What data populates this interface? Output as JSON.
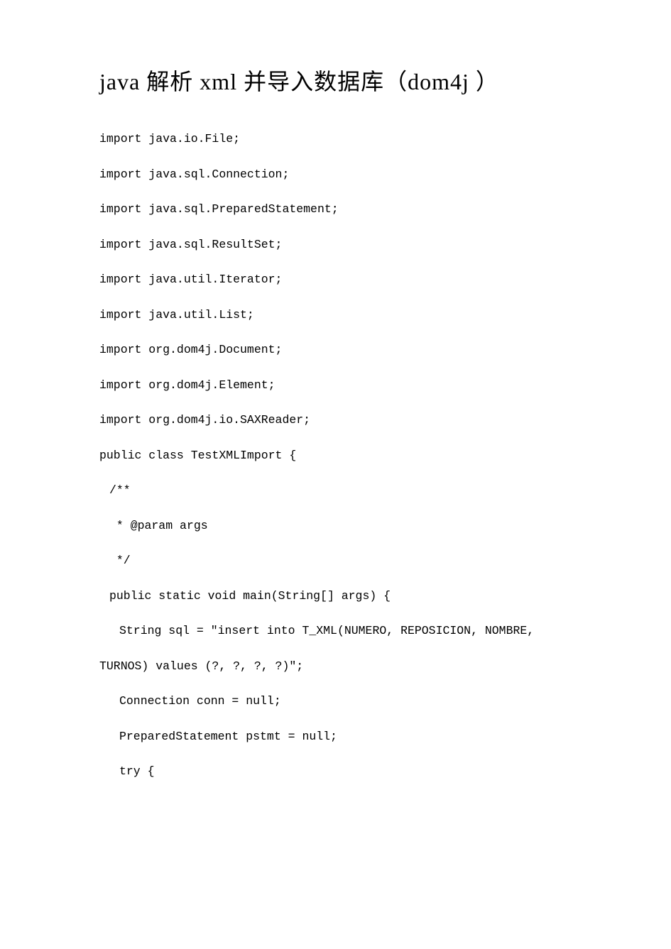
{
  "title": "java 解析 xml 并导入数据库（dom4j ）",
  "lines": [
    {
      "text": "import java.io.File;",
      "indent": 0
    },
    {
      "text": "import java.sql.Connection;",
      "indent": 0
    },
    {
      "text": "import java.sql.PreparedStatement;",
      "indent": 0
    },
    {
      "text": "import java.sql.ResultSet;",
      "indent": 0
    },
    {
      "text": "import java.util.Iterator;",
      "indent": 0
    },
    {
      "text": "import java.util.List;",
      "indent": 0
    },
    {
      "text": "",
      "indent": 0
    },
    {
      "text": "import org.dom4j.Document;",
      "indent": 0
    },
    {
      "text": "import org.dom4j.Element;",
      "indent": 0
    },
    {
      "text": "import org.dom4j.io.SAXReader;",
      "indent": 0
    },
    {
      "text": "",
      "indent": 0
    },
    {
      "text": "public class TestXMLImport {",
      "indent": 0
    },
    {
      "text": "",
      "indent": 0
    },
    {
      "text": "/**",
      "indent": 1
    },
    {
      "text": " * @param args",
      "indent": 1
    },
    {
      "text": " */",
      "indent": 1
    },
    {
      "text": "public static void main(String[] args) {",
      "indent": 1
    },
    {
      "text": "String sql = \"insert into T_XML(NUMERO, REPOSICION, NOMBRE,",
      "indent": 2
    },
    {
      "text": "TURNOS) values (?, ?, ?, ?)\";",
      "indent": 0
    },
    {
      "text": "Connection conn = null;",
      "indent": 2
    },
    {
      "text": "PreparedStatement pstmt = null;",
      "indent": 2
    },
    {
      "text": "try {",
      "indent": 2
    }
  ]
}
